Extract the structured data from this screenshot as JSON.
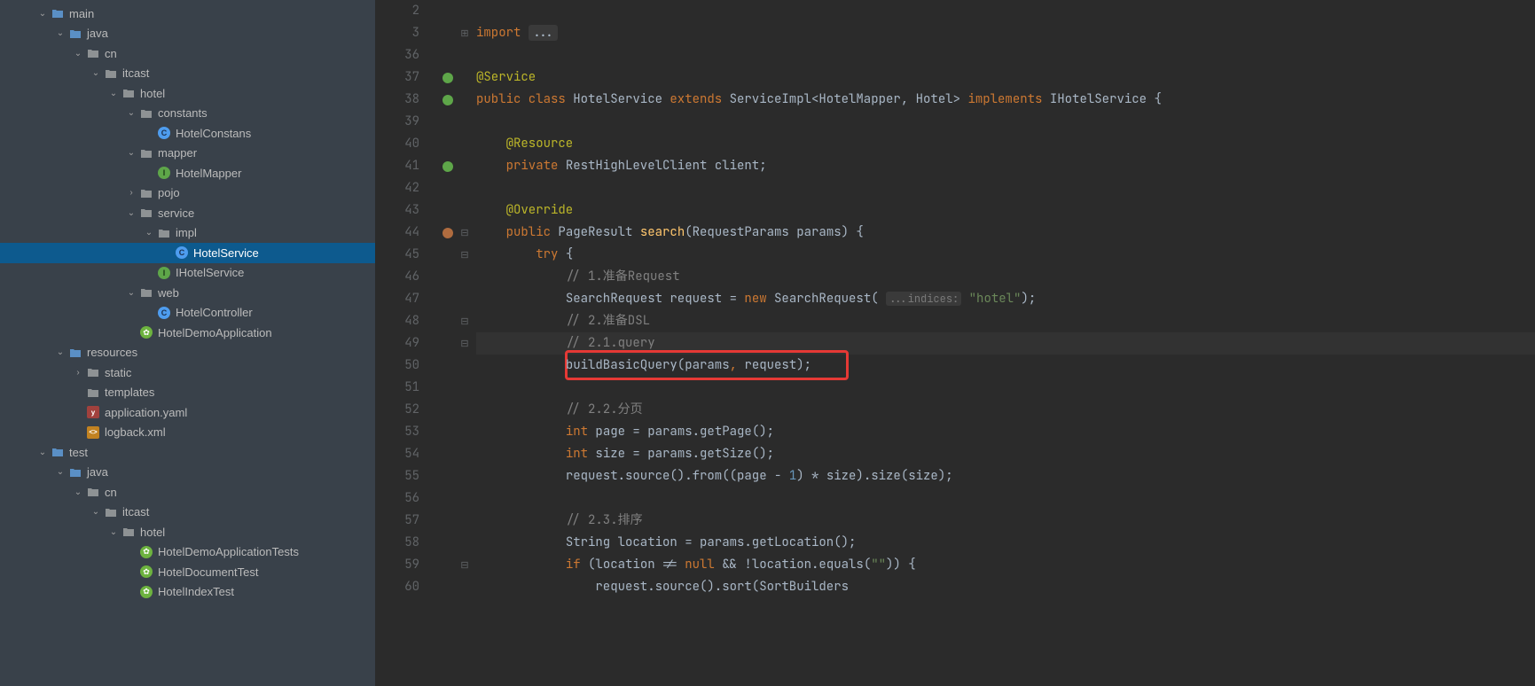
{
  "sidebar": {
    "items": [
      {
        "indent": 2,
        "exp": "down",
        "icon": "folder-blue",
        "label": "main"
      },
      {
        "indent": 3,
        "exp": "down",
        "icon": "folder-blue",
        "label": "java"
      },
      {
        "indent": 4,
        "exp": "down",
        "icon": "folder-gray",
        "label": "cn"
      },
      {
        "indent": 5,
        "exp": "down",
        "icon": "folder-gray",
        "label": "itcast"
      },
      {
        "indent": 6,
        "exp": "down",
        "icon": "folder-gray",
        "label": "hotel"
      },
      {
        "indent": 7,
        "exp": "down",
        "icon": "folder-gray",
        "label": "constants"
      },
      {
        "indent": 8,
        "exp": "",
        "icon": "class",
        "label": "HotelConstans"
      },
      {
        "indent": 7,
        "exp": "down",
        "icon": "folder-gray",
        "label": "mapper"
      },
      {
        "indent": 8,
        "exp": "",
        "icon": "interface",
        "label": "HotelMapper"
      },
      {
        "indent": 7,
        "exp": "right",
        "icon": "folder-gray",
        "label": "pojo"
      },
      {
        "indent": 7,
        "exp": "down",
        "icon": "folder-gray",
        "label": "service"
      },
      {
        "indent": 8,
        "exp": "down",
        "icon": "folder-gray",
        "label": "impl"
      },
      {
        "indent": 9,
        "exp": "",
        "icon": "class",
        "label": "HotelService",
        "selected": true
      },
      {
        "indent": 8,
        "exp": "",
        "icon": "interface",
        "label": "IHotelService"
      },
      {
        "indent": 7,
        "exp": "down",
        "icon": "folder-gray",
        "label": "web"
      },
      {
        "indent": 8,
        "exp": "",
        "icon": "class",
        "label": "HotelController"
      },
      {
        "indent": 7,
        "exp": "",
        "icon": "spring",
        "label": "HotelDemoApplication"
      },
      {
        "indent": 3,
        "exp": "down",
        "icon": "folder-blue",
        "label": "resources"
      },
      {
        "indent": 4,
        "exp": "right",
        "icon": "folder-gray",
        "label": "static"
      },
      {
        "indent": 4,
        "exp": "",
        "icon": "folder-gray",
        "label": "templates"
      },
      {
        "indent": 4,
        "exp": "",
        "icon": "yaml",
        "label": "application.yaml"
      },
      {
        "indent": 4,
        "exp": "",
        "icon": "xml",
        "label": "logback.xml"
      },
      {
        "indent": 2,
        "exp": "down",
        "icon": "folder-blue",
        "label": "test"
      },
      {
        "indent": 3,
        "exp": "down",
        "icon": "folder-blue",
        "label": "java"
      },
      {
        "indent": 4,
        "exp": "down",
        "icon": "folder-gray",
        "label": "cn"
      },
      {
        "indent": 5,
        "exp": "down",
        "icon": "folder-gray",
        "label": "itcast"
      },
      {
        "indent": 6,
        "exp": "down",
        "icon": "folder-gray",
        "label": "hotel"
      },
      {
        "indent": 7,
        "exp": "",
        "icon": "spring",
        "label": "HotelDemoApplicationTests"
      },
      {
        "indent": 7,
        "exp": "",
        "icon": "spring",
        "label": "HotelDocumentTest"
      },
      {
        "indent": 7,
        "exp": "",
        "icon": "spring",
        "label": "HotelIndexTest"
      }
    ]
  },
  "editor": {
    "lines": [
      {
        "n": 2,
        "tokens": []
      },
      {
        "n": 3,
        "fold": "⊞",
        "tokens": [
          {
            "t": "import ",
            "c": "c-keyword"
          },
          {
            "t": "...",
            "c": "c-fold"
          }
        ]
      },
      {
        "n": 36,
        "tokens": []
      },
      {
        "n": 37,
        "marker": "green",
        "fold": "",
        "tokens": [
          {
            "t": "@Service",
            "c": "c-anno"
          }
        ]
      },
      {
        "n": 38,
        "marker": "green",
        "tokens": [
          {
            "t": "public class ",
            "c": "c-keyword"
          },
          {
            "t": "HotelService ",
            "c": "c-class"
          },
          {
            "t": "extends ",
            "c": "c-keyword"
          },
          {
            "t": "ServiceImpl<HotelMapper",
            "c": "c-class"
          },
          {
            "t": ", ",
            "c": ""
          },
          {
            "t": "Hotel> ",
            "c": "c-class"
          },
          {
            "t": "implements ",
            "c": "c-keyword"
          },
          {
            "t": "IHotelService {",
            "c": "c-class"
          }
        ]
      },
      {
        "n": 39,
        "tokens": []
      },
      {
        "n": 40,
        "tokens": [
          {
            "t": "    ",
            "c": ""
          },
          {
            "t": "@Resource",
            "c": "c-anno"
          }
        ]
      },
      {
        "n": 41,
        "marker": "green",
        "tokens": [
          {
            "t": "    ",
            "c": ""
          },
          {
            "t": "private ",
            "c": "c-keyword"
          },
          {
            "t": "RestHighLevelClient ",
            "c": "c-class"
          },
          {
            "t": "client",
            "c": "c-param"
          },
          {
            "t": ";",
            "c": ""
          }
        ]
      },
      {
        "n": 42,
        "tokens": []
      },
      {
        "n": 43,
        "tokens": [
          {
            "t": "    ",
            "c": ""
          },
          {
            "t": "@Override",
            "c": "c-anno"
          }
        ]
      },
      {
        "n": 44,
        "marker": "override",
        "fold": "⊟",
        "tokens": [
          {
            "t": "    ",
            "c": ""
          },
          {
            "t": "public ",
            "c": "c-keyword"
          },
          {
            "t": "PageResult ",
            "c": "c-class"
          },
          {
            "t": "search",
            "c": "c-func"
          },
          {
            "t": "(RequestParams params) {",
            "c": "c-class"
          }
        ]
      },
      {
        "n": 45,
        "fold": "⊟",
        "tokens": [
          {
            "t": "        ",
            "c": ""
          },
          {
            "t": "try ",
            "c": "c-keyword"
          },
          {
            "t": "{",
            "c": ""
          }
        ]
      },
      {
        "n": 46,
        "tokens": [
          {
            "t": "            ",
            "c": ""
          },
          {
            "t": "// 1.准备Request",
            "c": "c-comment"
          }
        ]
      },
      {
        "n": 47,
        "tokens": [
          {
            "t": "            ",
            "c": ""
          },
          {
            "t": "SearchRequest request = ",
            "c": "c-class"
          },
          {
            "t": "new ",
            "c": "c-keyword"
          },
          {
            "t": "SearchRequest( ",
            "c": "c-class"
          },
          {
            "t": "...indices:",
            "c": "c-hint"
          },
          {
            "t": " ",
            "c": ""
          },
          {
            "t": "\"hotel\"",
            "c": "c-string"
          },
          {
            "t": ");",
            "c": ""
          }
        ]
      },
      {
        "n": 48,
        "fold": "⊟",
        "tokens": [
          {
            "t": "            ",
            "c": ""
          },
          {
            "t": "// 2.准备DSL",
            "c": "c-comment"
          }
        ]
      },
      {
        "n": 49,
        "fold": "⊟",
        "highlight": true,
        "tokens": [
          {
            "t": "            ",
            "c": ""
          },
          {
            "t": "// 2.1.query",
            "c": "c-comment"
          }
        ]
      },
      {
        "n": 50,
        "redbox": true,
        "tokens": [
          {
            "t": "            ",
            "c": ""
          },
          {
            "t": "buildBasicQuery(params",
            "c": "c-class"
          },
          {
            "t": ", ",
            "c": "c-keyword"
          },
          {
            "t": "request)",
            "c": "c-class"
          },
          {
            "t": ";",
            "c": ""
          }
        ]
      },
      {
        "n": 51,
        "tokens": []
      },
      {
        "n": 52,
        "tokens": [
          {
            "t": "            ",
            "c": ""
          },
          {
            "t": "// 2.2.分页",
            "c": "c-comment"
          }
        ]
      },
      {
        "n": 53,
        "tokens": [
          {
            "t": "            ",
            "c": ""
          },
          {
            "t": "int ",
            "c": "c-keyword"
          },
          {
            "t": "page = params.getPage();",
            "c": "c-class"
          }
        ]
      },
      {
        "n": 54,
        "tokens": [
          {
            "t": "            ",
            "c": ""
          },
          {
            "t": "int ",
            "c": "c-keyword"
          },
          {
            "t": "size = params.getSize();",
            "c": "c-class"
          }
        ]
      },
      {
        "n": 55,
        "tokens": [
          {
            "t": "            ",
            "c": ""
          },
          {
            "t": "request.source().from((page - ",
            "c": "c-class"
          },
          {
            "t": "1",
            "c": "c-number"
          },
          {
            "t": ") * size).size(size);",
            "c": "c-class"
          }
        ]
      },
      {
        "n": 56,
        "tokens": []
      },
      {
        "n": 57,
        "tokens": [
          {
            "t": "            ",
            "c": ""
          },
          {
            "t": "// 2.3.排序",
            "c": "c-comment"
          }
        ]
      },
      {
        "n": 58,
        "tokens": [
          {
            "t": "            ",
            "c": ""
          },
          {
            "t": "String location = params.getLocation();",
            "c": "c-class"
          }
        ]
      },
      {
        "n": 59,
        "fold": "⊟",
        "tokens": [
          {
            "t": "            ",
            "c": ""
          },
          {
            "t": "if ",
            "c": "c-keyword"
          },
          {
            "t": "(location != ",
            "c": "c-class"
          },
          {
            "t": "null ",
            "c": "c-keyword"
          },
          {
            "t": "&& !location.equals(",
            "c": "c-class"
          },
          {
            "t": "\"\"",
            "c": "c-string"
          },
          {
            "t": ")) {",
            "c": "c-class"
          }
        ]
      },
      {
        "n": 60,
        "tokens": [
          {
            "t": "                ",
            "c": ""
          },
          {
            "t": "request.source().sort(SortBuilders",
            "c": "c-class"
          }
        ]
      }
    ]
  }
}
